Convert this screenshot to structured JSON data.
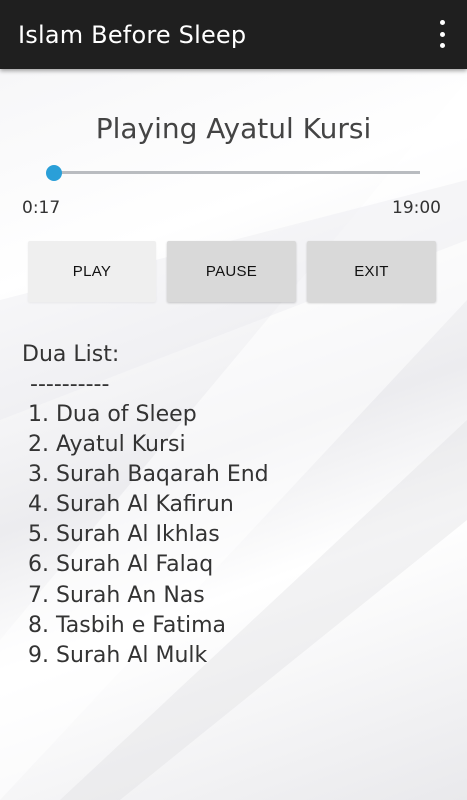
{
  "app": {
    "title": "Islam Before Sleep",
    "overflow_icon": "more-vertical-icon"
  },
  "player": {
    "now_playing": "Playing Ayatul Kursi",
    "current_time": "0:17",
    "total_time": "19:00",
    "progress_fraction": 0.015,
    "accent_color": "#2a9fd8"
  },
  "controls": {
    "play_label": "PLAY",
    "pause_label": "PAUSE",
    "exit_label": "EXIT"
  },
  "dua": {
    "heading": "Dua List:",
    "divider": "----------",
    "items": [
      "1. Dua of Sleep",
      "2. Ayatul Kursi",
      "3. Surah Baqarah End",
      "4. Surah Al Kafirun",
      "5. Surah Al Ikhlas",
      "6. Surah Al Falaq",
      "7. Surah An Nas",
      "8. Tasbih e Fatima",
      "9. Surah Al Mulk"
    ]
  }
}
